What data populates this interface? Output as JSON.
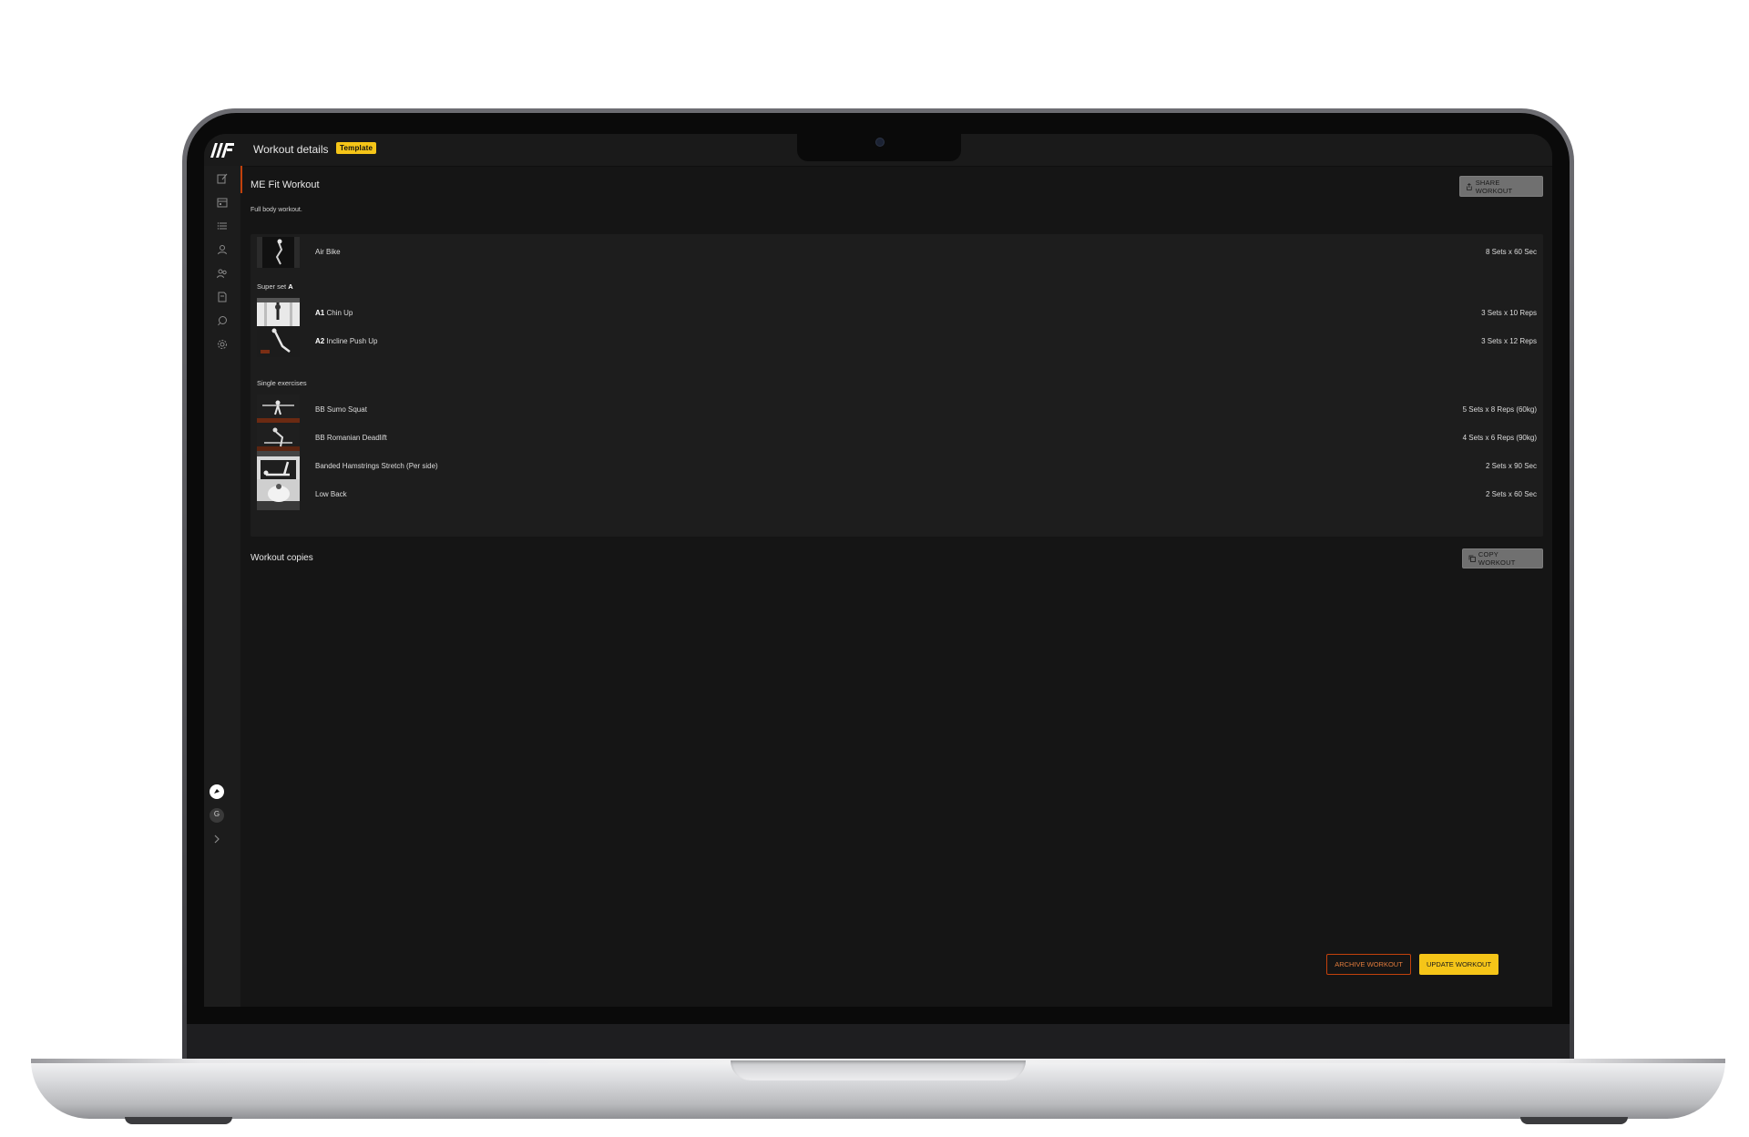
{
  "topbar": {
    "title": "Workout details",
    "badge": "Template"
  },
  "sidebar": {
    "nav_icons": [
      "edit-icon",
      "calendar-icon",
      "list-icon",
      "user-icon",
      "users-icon",
      "document-icon",
      "chat-icon",
      "settings-icon"
    ],
    "bottom": {
      "avatar_initial": "G"
    }
  },
  "workout": {
    "name": "ME Fit Workout",
    "description": "Full body workout.",
    "share_label": "SHARE WORKOUT"
  },
  "exercises": {
    "warmup": {
      "name": "Air Bike",
      "sets": "8 Sets x 60 Sec"
    },
    "superset_label_prefix": "Super set",
    "superset_label_letter": "A",
    "superset": [
      {
        "tag": "A1",
        "name": "Chin Up",
        "sets": "3 Sets x 10 Reps"
      },
      {
        "tag": "A2",
        "name": "Incline Push Up",
        "sets": "3 Sets x 12 Reps"
      }
    ],
    "single_label": "Single exercises",
    "single": [
      {
        "name": "BB Sumo Squat",
        "sets": "5 Sets x 8 Reps (60kg)"
      },
      {
        "name": "BB Romanian Deadlift",
        "sets": "4 Sets x 6 Reps (90kg)"
      },
      {
        "name": "Banded Hamstrings Stretch (Per side)",
        "sets": "2 Sets x 90 Sec"
      },
      {
        "name": "Low Back",
        "sets": "2 Sets x 60 Sec"
      }
    ]
  },
  "copies": {
    "title": "Workout copies",
    "copy_label": "COPY WORKOUT"
  },
  "actions": {
    "archive_label": "ARCHIVE WORKOUT",
    "update_label": "UPDATE WORKOUT"
  },
  "colors": {
    "accent_yellow": "#f5c518",
    "accent_orange": "#c2410c",
    "background": "#151515"
  }
}
